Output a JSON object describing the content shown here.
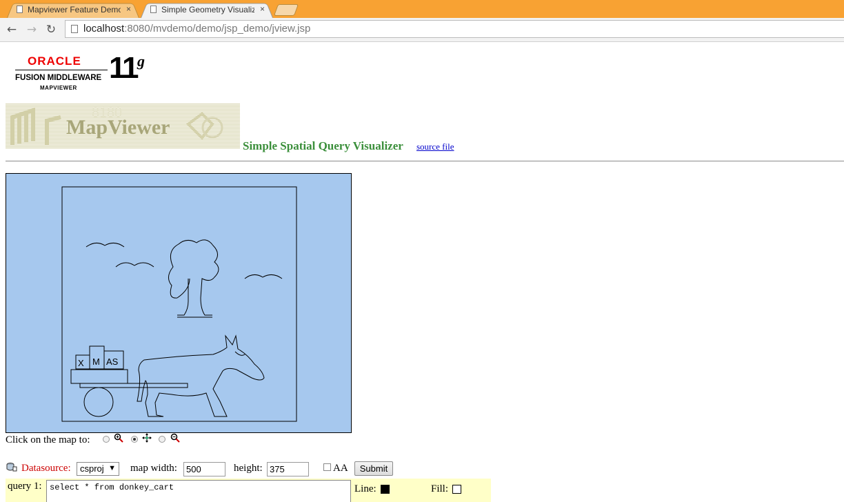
{
  "browser": {
    "tabs": [
      {
        "title": "Mapviewer Feature Demo",
        "active": false
      },
      {
        "title": "Simple Geometry Visualizer",
        "active": true
      }
    ],
    "close_glyph": "×",
    "url_host": "localhost",
    "url_rest": ":8080/mvdemo/demo/jsp_demo/jview.jsp",
    "icons": {
      "back": "←",
      "forward": "→",
      "reload": "↻"
    }
  },
  "logo": {
    "oracle": "ORACLE",
    "product_line": "FUSION MIDDLEWARE",
    "product": "MAPVIEWER",
    "version": "11",
    "version_suffix": "g"
  },
  "banner_text": "MapViewer",
  "title": "Simple Spatial Query Visualizer",
  "source_link": "source file",
  "map": {
    "background": "#a6c8ee",
    "box_letters": [
      "X",
      "M",
      "AS"
    ]
  },
  "click_mode": {
    "label": "Click on the map to:",
    "options": [
      {
        "name": "zoom-in",
        "checked": false
      },
      {
        "name": "pan",
        "checked": true
      },
      {
        "name": "zoom-out",
        "checked": false
      }
    ]
  },
  "form": {
    "datasource_label": "Datasource:",
    "datasource_value": "csproj",
    "map_width_label": "map width:",
    "map_width_value": "500",
    "height_label": "height:",
    "height_value": "375",
    "aa_label": "AA",
    "aa_checked": false,
    "submit_label": "Submit"
  },
  "query": {
    "label": "query 1:",
    "text": "select * from donkey_cart",
    "line_label": "Line:",
    "line_color": "#000000",
    "fill_label": "Fill:",
    "fill_color": "#ffffff"
  }
}
